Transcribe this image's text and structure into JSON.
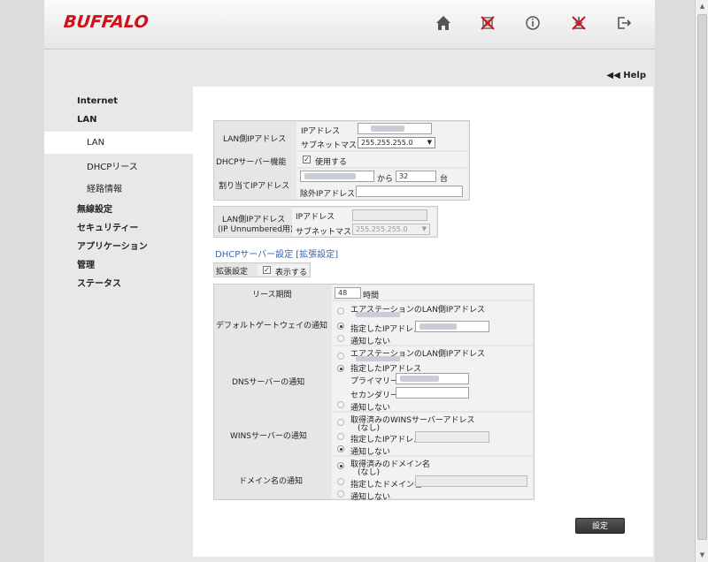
{
  "brand": "BUFFALO",
  "help_label": "Help",
  "nav": {
    "internet": "Internet",
    "lan": "LAN",
    "lan_sub": "LAN",
    "dhcp_lease": "DHCPリース",
    "routing": "経路情報",
    "wireless": "無線設定",
    "security": "セキュリティー",
    "application": "アプリケーション",
    "admin": "管理",
    "status": "ステータス"
  },
  "lan_ip": {
    "label": "LAN側IPアドレス",
    "ip_label": "IPアドレス",
    "mask_label": "サブネットマスク",
    "mask_value": "255.255.255.0"
  },
  "dhcp_server": {
    "label": "DHCPサーバー機能",
    "check_label": "使用する"
  },
  "assign_ip": {
    "label": "割り当てIPアドレス",
    "from_label": "から",
    "count_value": "32",
    "unit": "台",
    "exclude_label": "除外IPアドレス:"
  },
  "lan_unnumbered": {
    "label_line1": "LAN側IPアドレス",
    "label_line2": "(IP Unnumbered用)",
    "ip_label": "IPアドレス",
    "mask_label": "サブネットマスク",
    "mask_value": "255.255.255.0"
  },
  "ext_section": {
    "title": "DHCPサーバー設定 [拡張設定]",
    "ext_label": "拡張設定",
    "show_label": "表示する"
  },
  "lease": {
    "label": "リース期間",
    "value": "48",
    "unit": "時間"
  },
  "gateway": {
    "label": "デフォルトゲートウェイの通知",
    "opt1": "エアステーションのLAN側IPアドレス",
    "opt2": "指定したIPアドレス",
    "opt3": "通知しない"
  },
  "dns": {
    "label": "DNSサーバーの通知",
    "opt1": "エアステーションのLAN側IPアドレス",
    "opt2": "指定したIPアドレス",
    "primary_label": "プライマリー",
    "secondary_label": "セカンダリー",
    "opt3": "通知しない"
  },
  "wins": {
    "label": "WINSサーバーの通知",
    "opt1": "取得済みのWINSサーバーアドレス",
    "opt1_sub": "(なし)",
    "opt2": "指定したIPアドレス",
    "opt3": "通知しない"
  },
  "domain": {
    "label": "ドメイン名の通知",
    "opt1": "取得済みのドメイン名",
    "opt1_sub": "(なし)",
    "opt2": "指定したドメイン名",
    "opt3": "通知しない"
  },
  "submit_label": "設定",
  "colors": {
    "brand_red": "#d0101a",
    "link_blue": "#3a64b0",
    "button_dark": "#3a3a3a"
  }
}
